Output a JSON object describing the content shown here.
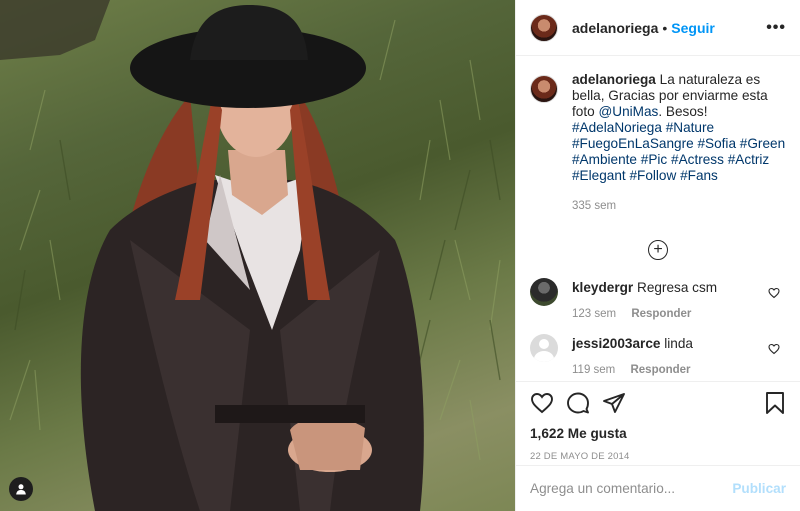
{
  "post": {
    "username": "adelanoriega",
    "follow_label": "Seguir",
    "more_label": "•••",
    "caption": {
      "username": "adelanoriega",
      "text": "La naturaleza es bella, Gracias por enviarme esta foto",
      "mention": "@UniMas",
      "after_mention": ". Besos!",
      "hashtags": [
        "#AdelaNoriega",
        "#Nature",
        "#FuegoEnLaSangre",
        "#Sofia",
        "#Green",
        "#Ambiente",
        "#Pic",
        "#Actress",
        "#Actriz",
        "#Elegant",
        "#Follow",
        "#Fans"
      ],
      "time": "335 sem"
    },
    "comments": [
      {
        "username": "kleydergr",
        "text": "Regresa csm",
        "time": "123 sem",
        "reply_label": "Responder"
      },
      {
        "username": "jessi2003arce",
        "text": "linda",
        "time": "119 sem",
        "reply_label": "Responder"
      }
    ],
    "likes_label": "1,622 Me gusta",
    "date_label": "22 DE MAYO DE 2014",
    "comment_input": {
      "placeholder": "Agrega un comentario...",
      "value": ""
    },
    "publish_label": "Publicar"
  },
  "icons": [
    "heart-icon",
    "comment-icon",
    "share-icon",
    "bookmark-icon",
    "plus-circle-icon",
    "more-icon",
    "user-tag-icon"
  ],
  "colors": {
    "accent": "#0095f6",
    "hashtag": "#00376b",
    "muted": "#8e8e8e",
    "publish_disabled": "#b2dffc"
  }
}
